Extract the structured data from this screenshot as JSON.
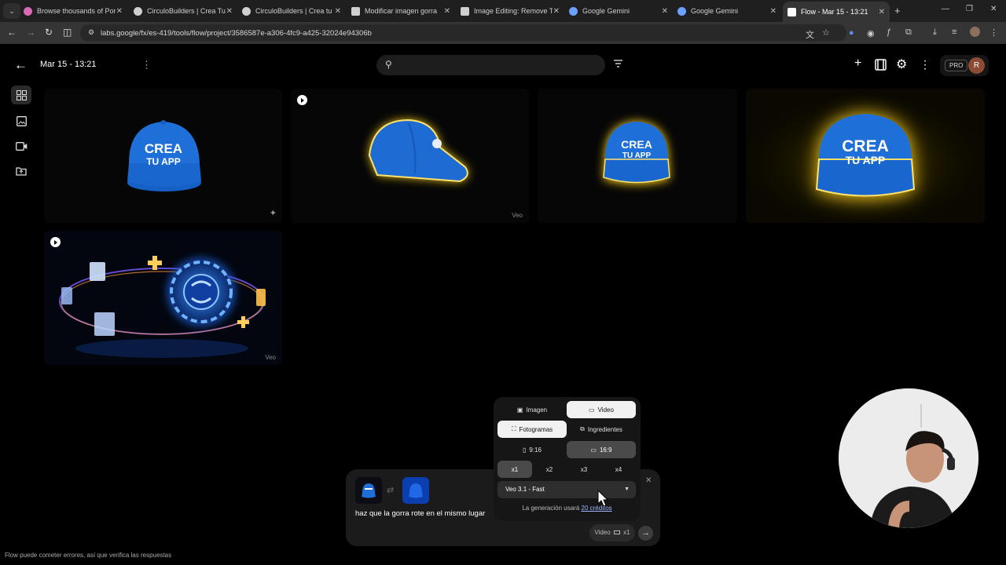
{
  "browser": {
    "tabs": [
      {
        "title": "Browse thousands of Por",
        "color": "#d96bb4"
      },
      {
        "title": "CirculoBuilders | Crea Tu",
        "color": "#cfcfcf"
      },
      {
        "title": "CirculoBuilders | Crea tu",
        "color": "#cfcfcf"
      },
      {
        "title": "Modificar imagen gorra",
        "color": "#cfcfcf"
      },
      {
        "title": "Image Editing: Remove Tr",
        "color": "#cfcfcf"
      },
      {
        "title": "Google Gemini",
        "color": "#6aa0ff"
      },
      {
        "title": "Google Gemini",
        "color": "#6aa0ff"
      },
      {
        "title": "Flow - Mar 15 - 13:21",
        "color": "#ffffff"
      }
    ],
    "url": "labs.google/fx/es-419/tools/flow/project/3586587e-a306-4fc9-a425-32024e94306b"
  },
  "header": {
    "project_title": "Mar 15 - 13:21",
    "search_placeholder": "",
    "plan_badge": "PRO",
    "avatar_initial": "R"
  },
  "grid": {
    "cards": [
      {
        "type": "image",
        "cap_text_line1": "CREA",
        "cap_text_line2": "TU APP",
        "glow": false
      },
      {
        "type": "video",
        "label": "Veo",
        "glow": true
      },
      {
        "type": "image",
        "cap_text_line1": "CREA",
        "cap_text_line2": "TU APP",
        "glow": true
      },
      {
        "type": "image",
        "cap_text_line1": "CREA",
        "cap_text_line2": "TU APP",
        "glow": true
      },
      {
        "type": "video",
        "label": "Veo",
        "glow": false
      }
    ]
  },
  "settings": {
    "media_tabs": [
      "Imagen",
      "Video"
    ],
    "media_selected": "Video",
    "mode_tabs": [
      "Fotogramas",
      "Ingredientes"
    ],
    "mode_selected": "Fotogramas",
    "aspect_tabs": [
      "9:16",
      "16:9"
    ],
    "aspect_selected": "16:9",
    "count_tabs": [
      "x1",
      "x2",
      "x3",
      "x4"
    ],
    "count_selected": "x1",
    "model": "Veo 3.1 - Fast",
    "credits_prefix": "La generación usará",
    "credits_link": "20 créditos"
  },
  "prompt": {
    "text": "haz que la gorra rote en el mismo lugar",
    "chip_label": "Video",
    "chip_count": "x1"
  },
  "footer": {
    "note": "Flow puede cometer errores, así que verifica las respuestas"
  }
}
